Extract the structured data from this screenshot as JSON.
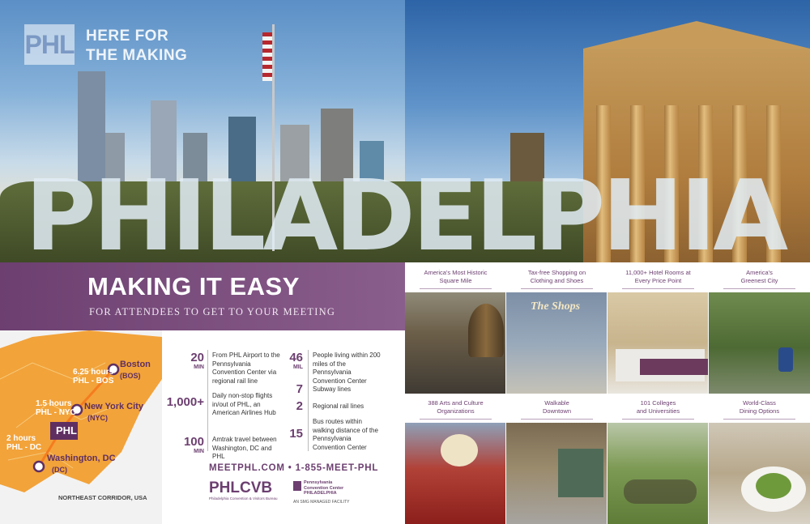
{
  "hero": {
    "logo_text": "PHL",
    "tagline_line1": "HERE FOR",
    "tagline_line2": "THE MAKING",
    "big_word": "PHILADELPHIA"
  },
  "band": {
    "title": "MAKING IT EASY",
    "subtitle": "FOR ATTENDEES TO GET TO YOUR MEETING"
  },
  "map": {
    "routes": [
      {
        "time": "6.25 hours",
        "route": "PHL - BOS"
      },
      {
        "time": "1.5 hours",
        "route": "PHL - NYC"
      },
      {
        "time": "2 hours",
        "route": "PHL - DC"
      }
    ],
    "cities": [
      {
        "name": "Boston",
        "code": "(BOS)"
      },
      {
        "name": "New York City",
        "code": "(NYC)"
      },
      {
        "name": "Washington, DC",
        "code": "(DC)"
      }
    ],
    "hub": "PHL",
    "caption": "NORTHEAST CORRIDOR, USA"
  },
  "stats_left": [
    {
      "num": "20",
      "unit": "MIN",
      "desc": "From PHL Airport to the Pennsylvania Convention Center via regional rail line"
    },
    {
      "num": "1,000+",
      "unit": "",
      "desc": "Daily non-stop flights in/out of PHL, an American Airlines Hub"
    },
    {
      "num": "100",
      "unit": "MIN",
      "desc": "Amtrak travel between Washington, DC and PHL"
    }
  ],
  "stats_right": [
    {
      "num": "46",
      "unit": "MIL",
      "desc": "People living within 200 miles of the Pennsylvania Convention Center"
    },
    {
      "num": "7",
      "unit": "",
      "desc": "Subway lines"
    },
    {
      "num": "2",
      "unit": "",
      "desc": "Regional rail lines"
    },
    {
      "num": "15",
      "unit": "",
      "desc": "Bus routes within walking distance of the Pennsylvania Convention Center"
    }
  ],
  "contact": "MEETPHL.COM • 1-855-MEET-PHL",
  "footer": {
    "cvb_logo": "PHLCVB",
    "cvb_sub": "Philadelphia Convention & Visitors Bureau",
    "pcc_line1": "Pennsylvania",
    "pcc_line2": "Convention Center",
    "pcc_line3": "PHILADELPHIA",
    "smg": "AN SMG MANAGED FACILITY"
  },
  "captions_top": [
    {
      "l1": "America's Most Historic",
      "l2": "Square Mile"
    },
    {
      "l1": "Tax-free Shopping on",
      "l2": "Clothing and Shoes"
    },
    {
      "l1": "11,000+ Hotel Rooms at",
      "l2": "Every Price Point"
    },
    {
      "l1": "America's",
      "l2": "Greenest City"
    }
  ],
  "captions_bottom": [
    {
      "l1": "388 Arts and Culture",
      "l2": "Organizations"
    },
    {
      "l1": "Walkable",
      "l2": "Downtown"
    },
    {
      "l1": "101 Colleges",
      "l2": "and Universities"
    },
    {
      "l1": "World-Class",
      "l2": "Dining Options"
    }
  ],
  "shops_sign": "The Shops",
  "colors": {
    "purple": "#6c3f70",
    "map_orange": "#f2a33a",
    "route_line": "#f57c1f"
  }
}
